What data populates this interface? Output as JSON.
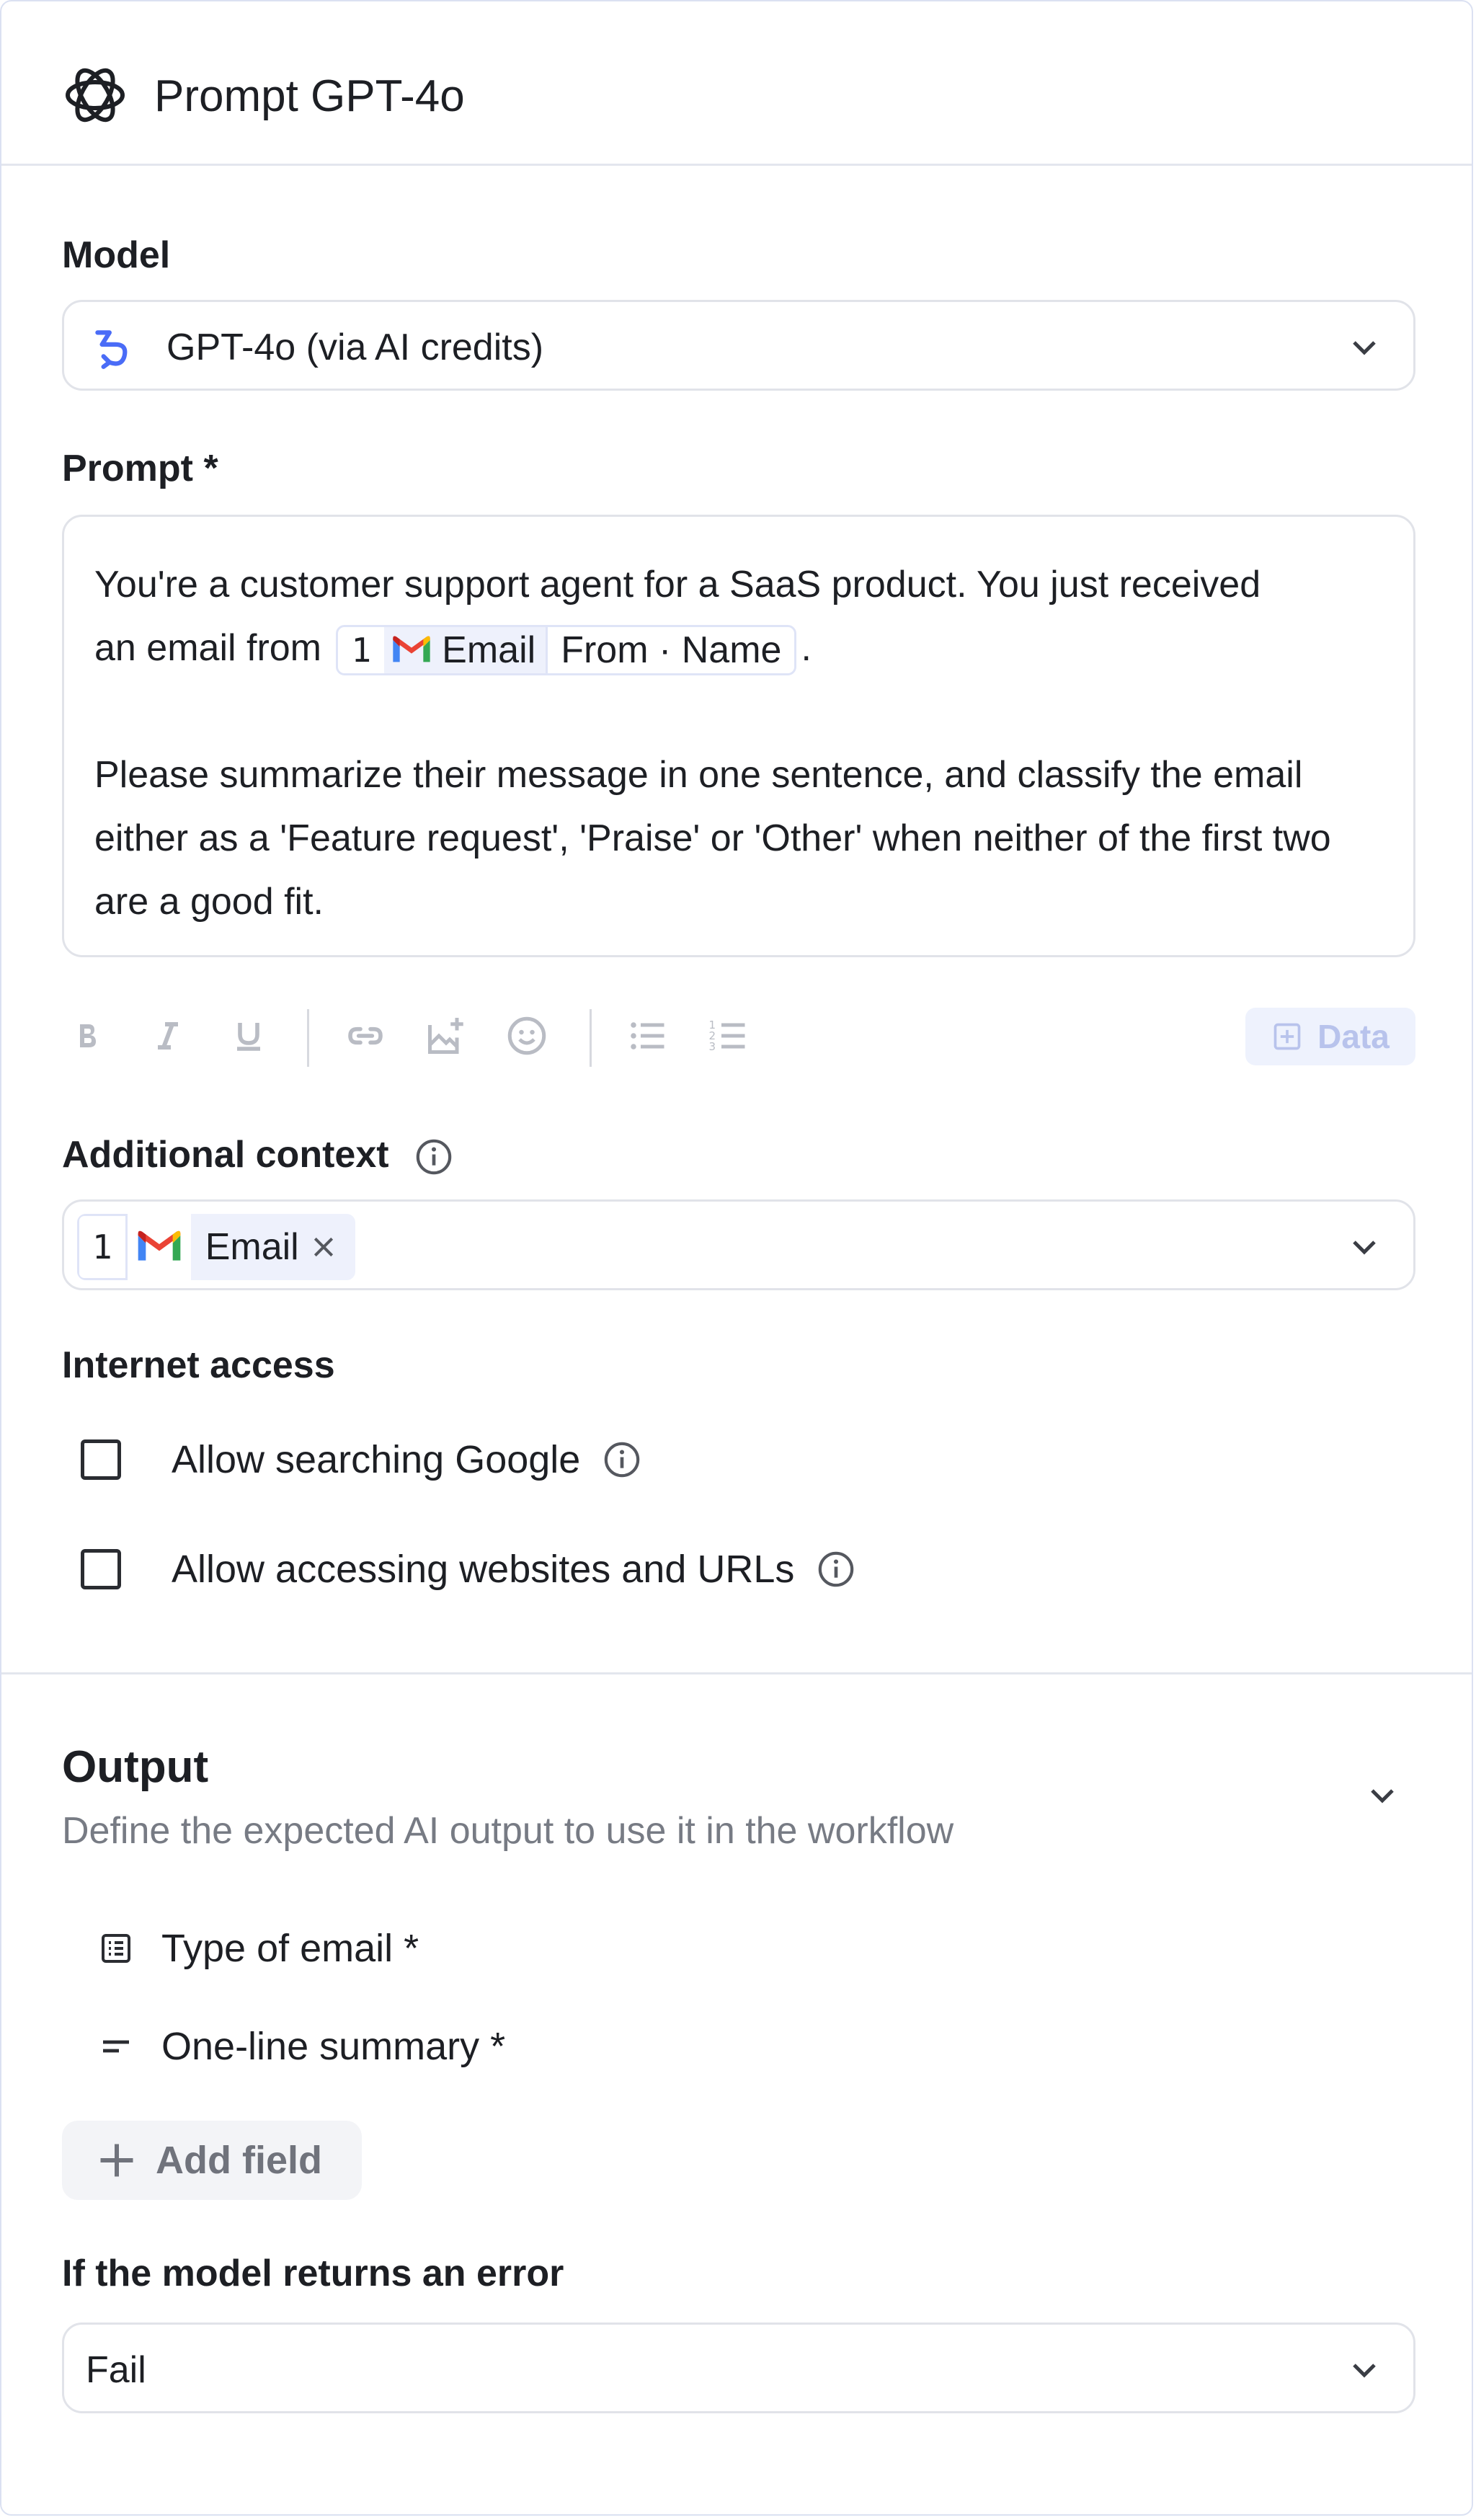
{
  "header": {
    "title": "Prompt GPT-4o",
    "icon": "openai-logo-icon"
  },
  "model": {
    "label": "Model",
    "value": "GPT-4o (via AI credits)"
  },
  "prompt": {
    "label": "Prompt *",
    "line1": "You're a customer support agent for a SaaS product. You just received",
    "line2_before": "an email from",
    "chip": {
      "step": "1",
      "app": "Email",
      "field": "From · Name"
    },
    "line2_after": ".",
    "paragraph2": "Please summarize their message in one sentence, and classify the email either as a 'Feature request', 'Praise' or 'Other' when neither of the first two are a good fit."
  },
  "toolbar": {
    "items": [
      "bold-icon",
      "italic-icon",
      "underline-icon",
      "link-icon",
      "image-add-icon",
      "emoji-icon",
      "bullet-list-icon",
      "numbered-list-icon"
    ],
    "data_label": "Data"
  },
  "additional_context": {
    "label": "Additional context",
    "chip": {
      "step": "1",
      "app": "Email"
    }
  },
  "internet": {
    "label": "Internet access",
    "options": [
      {
        "label": "Allow searching Google",
        "checked": false
      },
      {
        "label": "Allow accessing websites and URLs",
        "checked": false
      }
    ]
  },
  "output": {
    "title": "Output",
    "subtitle": "Define the expected AI output to use it in the workflow",
    "fields": [
      {
        "label": "Type of email *",
        "icon": "list-box-icon"
      },
      {
        "label": "One-line summary *",
        "icon": "short-text-icon"
      }
    ],
    "add_label": "Add field"
  },
  "error": {
    "label": "If the model returns an error",
    "value": "Fail"
  },
  "colors": {
    "accent": "#4a6cf7",
    "border": "#e1e3e9",
    "chip_bg": "#eef1fc"
  }
}
